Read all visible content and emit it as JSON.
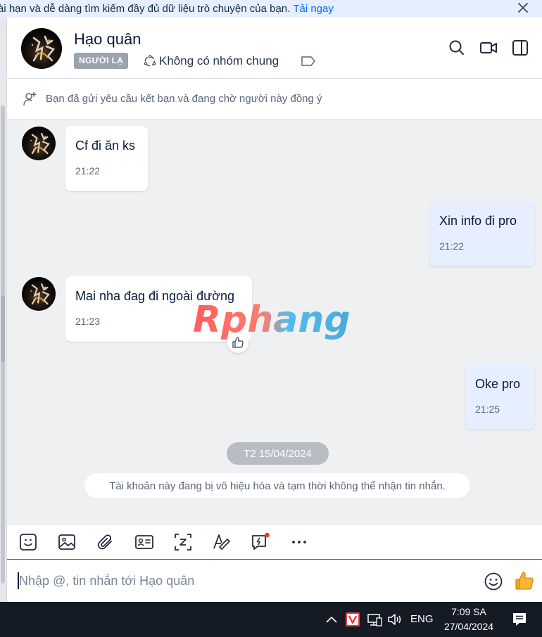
{
  "banner": {
    "text": "ài hạn và dễ dàng tìm kiếm đầy đủ dữ liệu trò chuyện của bạn.",
    "link": "Tải ngay",
    "close_icon": "close-icon"
  },
  "header": {
    "contact_name": "Hạo quân",
    "badge": "NGƯỜI LẠ",
    "group_text": "Không có nhóm chung",
    "icons": [
      "search-icon",
      "video-call-icon",
      "panel-toggle-icon"
    ]
  },
  "notice": {
    "text": "Bạn đã gửi yêu cầu kết bạn và đang chờ người này đồng ý"
  },
  "messages": [
    {
      "from": "contact",
      "text": "Cf đi ăn ks",
      "time": "21:22"
    },
    {
      "from": "me",
      "text": "Xin info đi pro",
      "time": "21:22"
    },
    {
      "from": "contact",
      "text": "Mai nha đag đi ngoài đường",
      "time": "21:23"
    },
    {
      "from": "me",
      "text": "Oke pro",
      "time": "21:25"
    }
  ],
  "date_divider": "T2 15/04/2024",
  "system_message": "Tài khoản này đang bị vô hiệu hóa và tạm thời không thể nhận tin nhắn.",
  "watermark": {
    "text": "Rphang"
  },
  "toolbar": {
    "icons": [
      "sticker-icon",
      "image-icon",
      "attachment-icon",
      "contact-card-icon",
      "screenshot-icon",
      "text-format-icon",
      "quick-message-icon",
      "more-icon"
    ]
  },
  "composer": {
    "placeholder": "Nhập @, tin nhắn tới Hạo quân",
    "value": ""
  },
  "taskbar": {
    "language": "ENG",
    "time": "7:09 SA",
    "date": "27/04/2024"
  },
  "colors": {
    "accent": "#0068ff",
    "my_bubble": "#e5efff",
    "badge": "#9aa3ae",
    "notification_dot": "#e53935"
  }
}
